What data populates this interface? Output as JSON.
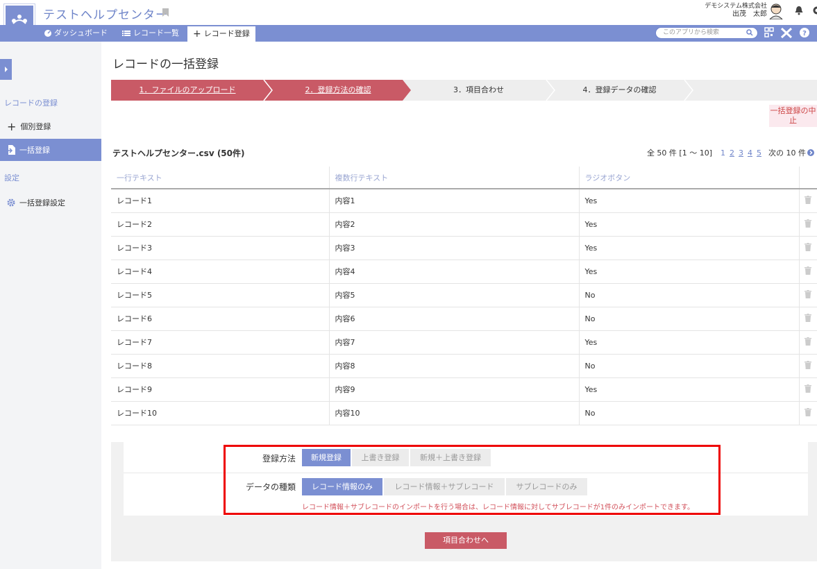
{
  "header": {
    "app_title": "テストヘルプセンター",
    "company": "デモシステム株式会社",
    "user": "出茂　太郎"
  },
  "nav": {
    "dashboard": "ダッシュボード",
    "record_list": "レコード一覧",
    "record_register": "レコード登録",
    "search_placeholder": "このアプリから検索"
  },
  "sidebar": {
    "section_register": "レコードの登録",
    "item_single": "個別登録",
    "item_bulk": "一括登録",
    "section_settings": "設定",
    "item_bulk_settings": "一括登録設定"
  },
  "main": {
    "page_title": "レコードの一括登録",
    "steps": [
      "1．ファイルのアップロード",
      "2．登録方法の確認",
      "3．項目合わせ",
      "4．登録データの確認"
    ],
    "cancel_label": "一括登録の中止",
    "file_title": "テストヘルプセンター.csv (50件)",
    "pager": {
      "summary": "全 50 件 [1 〜 10]",
      "current": "1",
      "pages": [
        "2",
        "3",
        "4",
        "5"
      ],
      "next": "次の 10 件"
    },
    "table": {
      "headers": [
        "一行テキスト",
        "複数行テキスト",
        "ラジオボタン"
      ],
      "rows": [
        [
          "レコード1",
          "内容1",
          "Yes"
        ],
        [
          "レコード2",
          "内容2",
          "Yes"
        ],
        [
          "レコード3",
          "内容3",
          "Yes"
        ],
        [
          "レコード4",
          "内容4",
          "Yes"
        ],
        [
          "レコード5",
          "内容5",
          "No"
        ],
        [
          "レコード6",
          "内容6",
          "No"
        ],
        [
          "レコード7",
          "内容7",
          "Yes"
        ],
        [
          "レコード8",
          "内容8",
          "No"
        ],
        [
          "レコード9",
          "内容9",
          "Yes"
        ],
        [
          "レコード10",
          "内容10",
          "No"
        ]
      ]
    },
    "options": {
      "method_label": "登録方法",
      "method_choices": [
        "新規登録",
        "上書き登録",
        "新規＋上書き登録"
      ],
      "method_selected": "新規登録",
      "type_label": "データの種類",
      "type_choices": [
        "レコード情報のみ",
        "レコード情報＋サブレコード",
        "サブレコードのみ"
      ],
      "type_selected": "レコード情報のみ",
      "note": "レコード情報＋サブレコードのインポートを行う場合は、レコード情報に対してサブレコードが1件のみインポートできます。"
    },
    "next_button": "項目合わせへ"
  },
  "colors": {
    "accent": "#7b8fd2",
    "step_done": "#c95a66",
    "highlight_frame": "#e00000"
  }
}
